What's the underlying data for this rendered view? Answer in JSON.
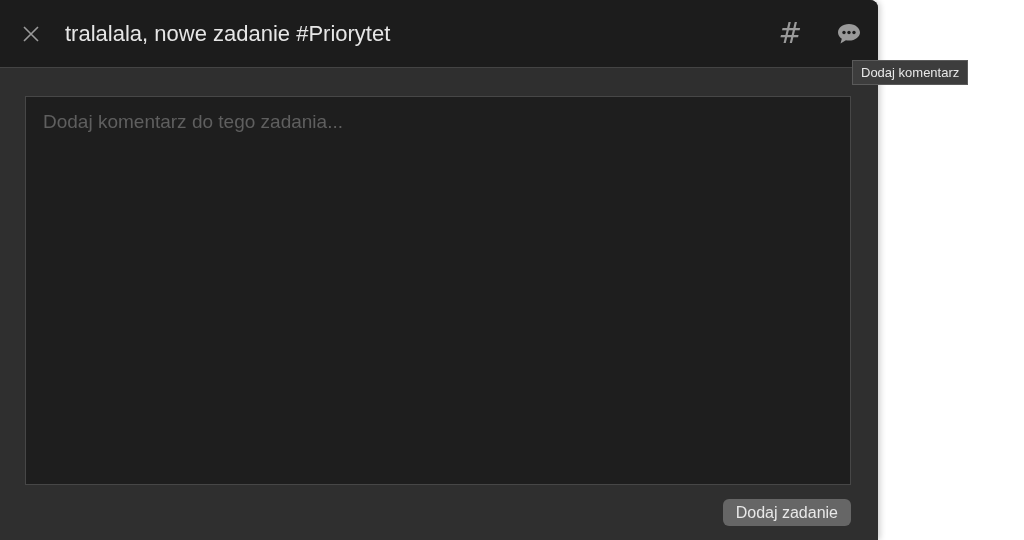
{
  "header": {
    "title": "tralalala, nowe zadanie #Priorytet",
    "tag_button": "#"
  },
  "tooltip": {
    "text": "Dodaj komentarz"
  },
  "comment": {
    "placeholder": "Dodaj komentarz do tego zadania..."
  },
  "buttons": [
    "Dodaj zadanie"
  ]
}
